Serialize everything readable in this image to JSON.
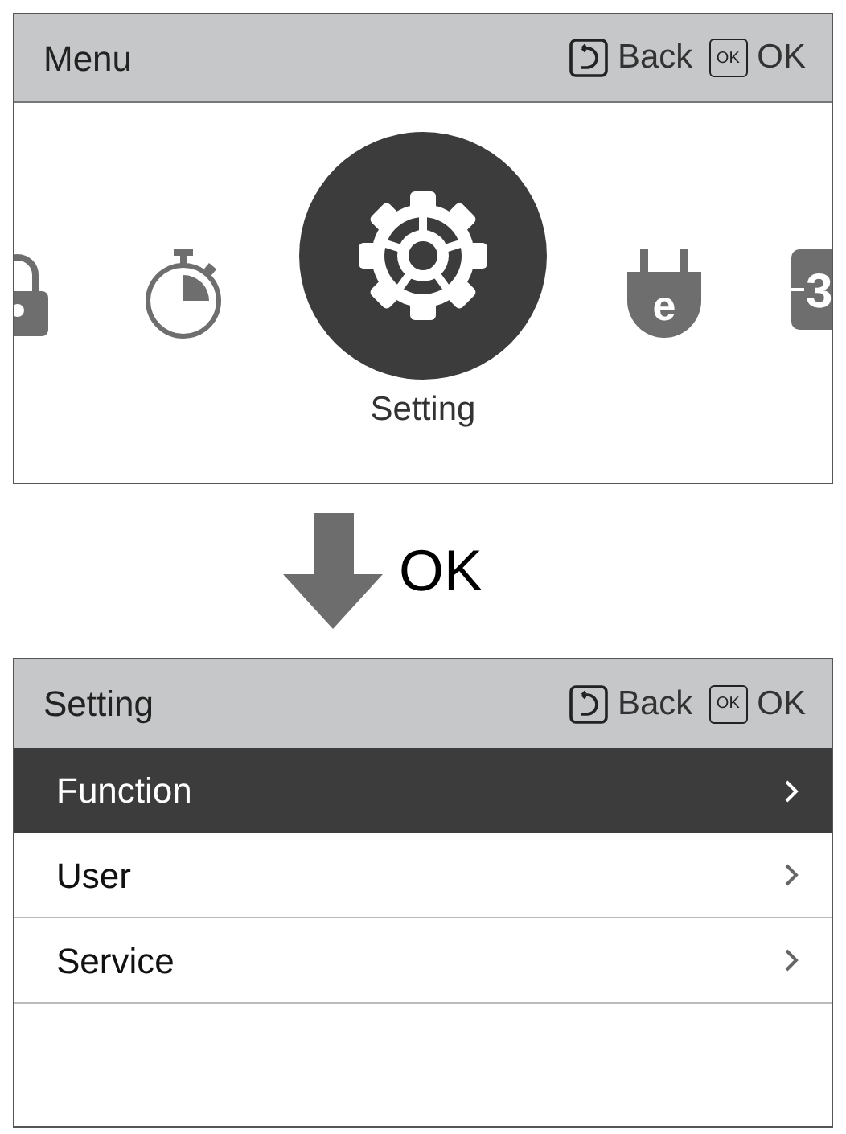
{
  "menu_screen": {
    "title": "Menu",
    "keys": [
      {
        "kind": "back",
        "label": "Back"
      },
      {
        "kind": "ok",
        "key_glyph": "OK",
        "label": "OK"
      }
    ],
    "carousel": [
      {
        "kind": "lock",
        "selected": false
      },
      {
        "kind": "timer",
        "selected": false
      },
      {
        "kind": "setting",
        "selected": true,
        "label": "Setting"
      },
      {
        "kind": "plug",
        "selected": false,
        "glyph": "e"
      },
      {
        "kind": "number",
        "selected": false,
        "glyph": "3"
      }
    ]
  },
  "transition": {
    "label": "OK"
  },
  "setting_screen": {
    "title": "Setting",
    "keys": [
      {
        "kind": "back",
        "label": "Back"
      },
      {
        "kind": "ok",
        "key_glyph": "OK",
        "label": "OK"
      }
    ],
    "items": [
      {
        "label": "Function",
        "selected": true
      },
      {
        "label": "User",
        "selected": false
      },
      {
        "label": "Service",
        "selected": false
      }
    ]
  }
}
